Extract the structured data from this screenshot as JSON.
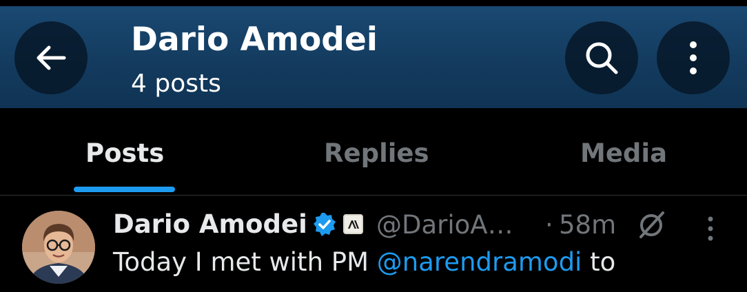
{
  "header": {
    "title": "Dario Amodei",
    "subtitle": "4 posts",
    "back_icon": "arrow-left-icon",
    "search_icon": "search-icon",
    "more_icon": "more-vertical-icon"
  },
  "tabs": [
    {
      "label": "Posts",
      "active": true
    },
    {
      "label": "Replies",
      "active": false
    },
    {
      "label": "Media",
      "active": false
    }
  ],
  "post": {
    "author": "Dario Amodei",
    "verified_icon": "verified-badge-icon",
    "affiliate_icon": "anthropic-logo-icon",
    "handle": "@DarioA…",
    "separator": "·",
    "time": "58m",
    "grok_icon": "grok-icon",
    "more_icon": "more-vertical-icon",
    "text_before": "Today I met with PM ",
    "mention": "@narendramodi",
    "text_after": " to"
  },
  "colors": {
    "header_bg": "#143c60",
    "accent": "#1d9bf0",
    "muted": "#71767b",
    "text": "#e7e9ea",
    "background": "#000000"
  }
}
